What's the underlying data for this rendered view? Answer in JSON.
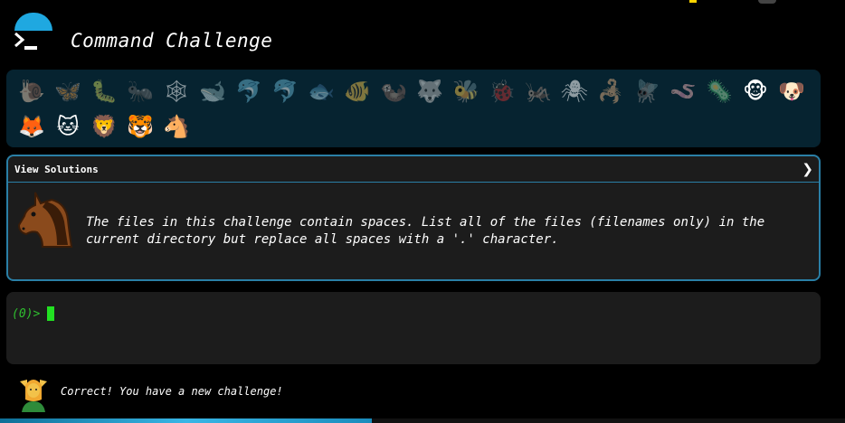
{
  "header": {
    "title": "Command Challenge"
  },
  "animals": {
    "row1": [
      "🐌",
      "🦋",
      "🐛",
      "🐜",
      "🕸",
      "🐋",
      "🐬",
      "🐬",
      "🐟",
      "🐠",
      "🦦",
      "🐺",
      "🐝",
      "🐞",
      "🦗",
      "🕷",
      "🦂",
      "🪰",
      "🪱",
      "🦠",
      "🐵",
      "🐶"
    ],
    "row2": [
      "🦊",
      "🐱",
      "🦁",
      "🐯",
      "🐴"
    ]
  },
  "challenge": {
    "solutions_label": "View Solutions",
    "chevron": "❯",
    "text_line1": "The files in this challenge contain spaces. List all of the files (filenames only) in the",
    "text_line2": "current directory but replace all spaces with a '.' character."
  },
  "terminal": {
    "prompt": "(0)>"
  },
  "status": {
    "message": "Correct! You have a new challenge!"
  },
  "progress": {
    "fraction": 0.44
  }
}
